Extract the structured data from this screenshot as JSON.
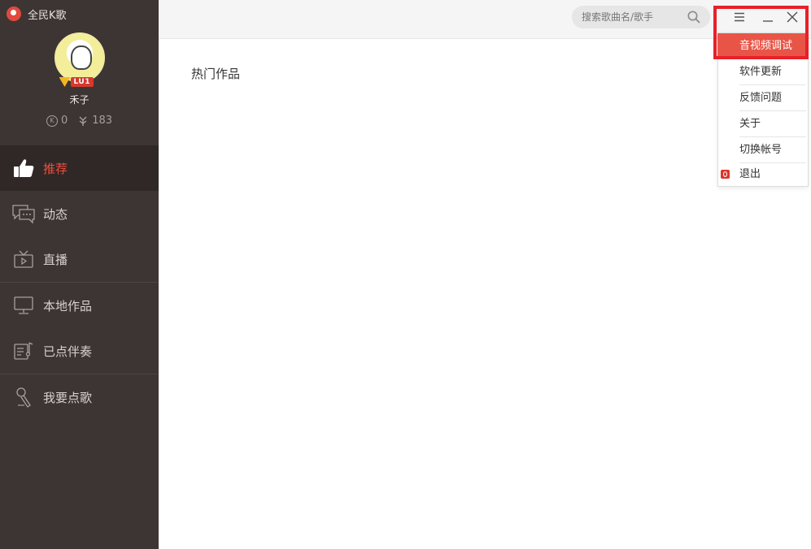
{
  "app": {
    "title": "全民K歌"
  },
  "profile": {
    "username": "禾子",
    "level": "LU1",
    "coins": "0",
    "flowers": "183"
  },
  "nav": {
    "items": [
      {
        "label": "推荐",
        "icon": "thumbs-up-icon",
        "active": true
      },
      {
        "label": "动态",
        "icon": "chat-bubbles-icon"
      },
      {
        "label": "直播",
        "icon": "tv-play-icon"
      },
      {
        "label": "本地作品",
        "icon": "monitor-icon"
      },
      {
        "label": "已点伴奏",
        "icon": "music-list-icon"
      },
      {
        "label": "我要点歌",
        "icon": "microphone-icon"
      }
    ]
  },
  "search": {
    "placeholder": "搜索歌曲名/歌手"
  },
  "main": {
    "section_title": "热门作品"
  },
  "menu": {
    "items": [
      {
        "label": "音视频调试",
        "highlighted": true
      },
      {
        "label": "软件更新"
      },
      {
        "label": "反馈问题"
      },
      {
        "label": "关于"
      },
      {
        "label": "切换帐号"
      },
      {
        "label": "退出"
      }
    ]
  },
  "colors": {
    "sidebar_bg": "#3d3534",
    "accent": "#f04d3c",
    "menu_highlight": "#e85547",
    "annotation_box": "#e8202a"
  }
}
